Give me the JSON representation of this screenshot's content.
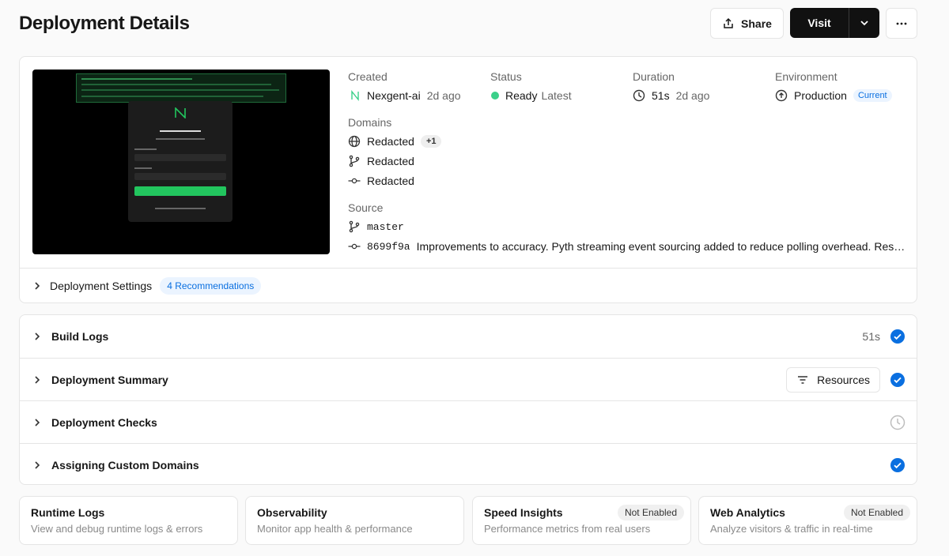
{
  "header": {
    "title": "Deployment Details",
    "share_label": "Share",
    "visit_label": "Visit"
  },
  "deployment": {
    "created": {
      "label": "Created",
      "author": "Nexgent-ai",
      "time": "2d ago"
    },
    "status": {
      "label": "Status",
      "value": "Ready",
      "tag": "Latest",
      "color": "#3bd08a"
    },
    "duration": {
      "label": "Duration",
      "value": "51s",
      "time": "2d ago"
    },
    "environment": {
      "label": "Environment",
      "value": "Production",
      "badge": "Current"
    },
    "domains": {
      "label": "Domains",
      "items": [
        {
          "icon": "globe-icon",
          "text": "Redacted",
          "extra": "+1"
        },
        {
          "icon": "branch-icon",
          "text": "Redacted"
        },
        {
          "icon": "commit-icon",
          "text": "Redacted"
        }
      ]
    },
    "source": {
      "label": "Source",
      "branch": "master",
      "commit_hash": "8699f9a",
      "commit_message": "Improvements to accuracy. Pyth streaming event sourcing added to reduce polling overhead. Resolve…"
    },
    "settings": {
      "label": "Deployment Settings",
      "recommendations": "4 Recommendations"
    }
  },
  "steps": [
    {
      "label": "Build Logs",
      "right_text": "51s",
      "status": "complete"
    },
    {
      "label": "Deployment Summary",
      "button": "Resources",
      "status": "complete"
    },
    {
      "label": "Deployment Checks",
      "status": "pending"
    },
    {
      "label": "Assigning Custom Domains",
      "status": "complete"
    }
  ],
  "cards": [
    {
      "title": "Runtime Logs",
      "subtitle": "View and debug runtime logs & errors"
    },
    {
      "title": "Observability",
      "subtitle": "Monitor app health & performance"
    },
    {
      "title": "Speed Insights",
      "subtitle": "Performance metrics from real users",
      "badge": "Not Enabled"
    },
    {
      "title": "Web Analytics",
      "subtitle": "Analyze visitors & traffic in real-time",
      "badge": "Not Enabled"
    }
  ],
  "colors": {
    "accent": "#0a6fe0",
    "success": "#3bd08a"
  }
}
